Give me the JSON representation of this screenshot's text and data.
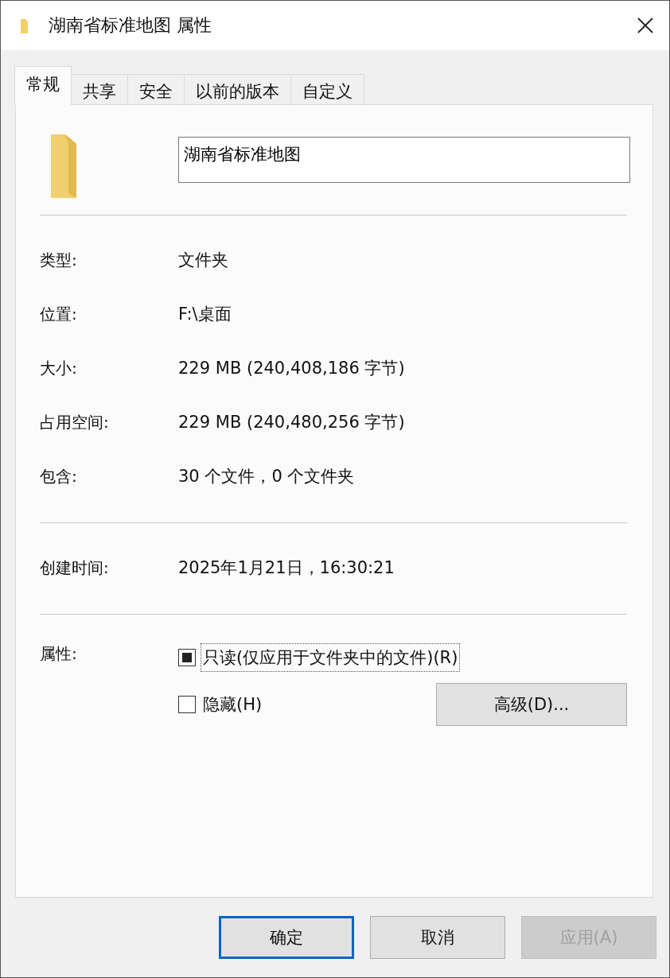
{
  "window": {
    "title": "湖南省标准地图 属性"
  },
  "tabs": [
    {
      "label": "常规",
      "selected": true
    },
    {
      "label": "共享",
      "selected": false
    },
    {
      "label": "安全",
      "selected": false
    },
    {
      "label": "以前的版本",
      "selected": false
    },
    {
      "label": "自定义",
      "selected": false
    }
  ],
  "name_field": {
    "value": "湖南省标准地图"
  },
  "info_groups": [
    [
      {
        "label": "类型:",
        "value": "文件夹"
      },
      {
        "label": "位置:",
        "value": "F:\\桌面"
      },
      {
        "label": "大小:",
        "value": "229 MB (240,408,186 字节)"
      },
      {
        "label": "占用空间:",
        "value": "229 MB (240,480,256 字节)"
      },
      {
        "label": "包含:",
        "value": "30 个文件，0 个文件夹"
      }
    ],
    [
      {
        "label": "创建时间:",
        "value": "2025年1月21日，16:30:21"
      }
    ]
  ],
  "attributes": {
    "label": "属性:",
    "options": [
      {
        "label": "只读(仅应用于文件夹中的文件)(R)",
        "checked": true,
        "focused": true
      },
      {
        "label": "隐藏(H)",
        "checked": false,
        "focused": false
      }
    ],
    "advanced_button": "高级(D)..."
  },
  "buttons": [
    {
      "label": "确定",
      "default": true,
      "disabled": false
    },
    {
      "label": "取消",
      "default": false,
      "disabled": false
    },
    {
      "label": "应用(A)",
      "default": false,
      "disabled": true
    }
  ]
}
